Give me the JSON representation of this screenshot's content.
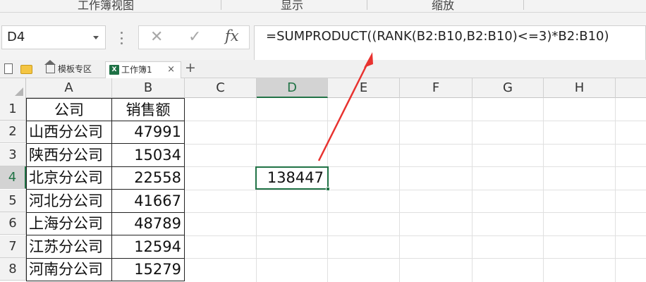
{
  "ribbon": {
    "group_labels": [
      "工作簿视图",
      "显示",
      "缩放"
    ]
  },
  "formula_bar": {
    "name_box": "D4",
    "cancel_glyph": "✕",
    "enter_glyph": "✓",
    "fx_label": "fx",
    "formula": "=SUMPRODUCT((RANK(B2:B10,B2:B10)<=3)*B2:B10)"
  },
  "tabs": {
    "template_tab": "模板专区",
    "sheet_tab": "工作簿1",
    "xls_badge": "X",
    "close_glyph": "×",
    "add_glyph": "+"
  },
  "columns": [
    "A",
    "B",
    "C",
    "D",
    "E",
    "F",
    "G",
    "H"
  ],
  "rows": [
    "1",
    "2",
    "3",
    "4",
    "5",
    "6",
    "7",
    "8"
  ],
  "table": {
    "header": [
      "公司",
      "销售额"
    ],
    "data": [
      [
        "山西分公司",
        "47991"
      ],
      [
        "陕西分公司",
        "15034"
      ],
      [
        "北京分公司",
        "22558"
      ],
      [
        "河北分公司",
        "41667"
      ],
      [
        "上海分公司",
        "48789"
      ],
      [
        "江苏分公司",
        "12594"
      ],
      [
        "河南分公司",
        "15279"
      ]
    ]
  },
  "result_cell": {
    "ref": "D4",
    "value": "138447"
  },
  "colors": {
    "accent": "#217346",
    "arrow": "#e8322f"
  }
}
